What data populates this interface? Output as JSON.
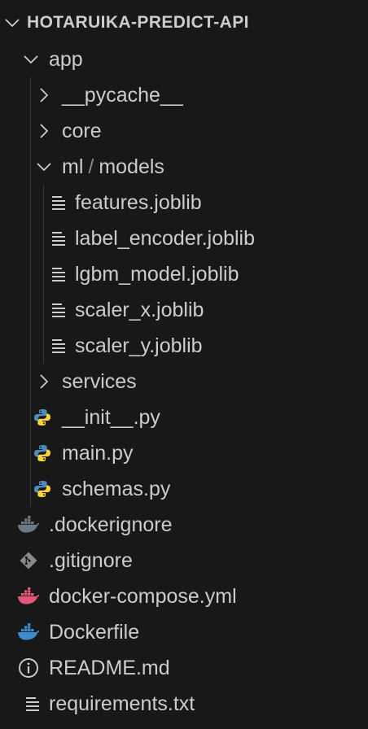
{
  "project": {
    "name": "HOTARUIKA-PREDICT-API"
  },
  "tree": {
    "app": "app",
    "pycache": "__pycache__",
    "core": "core",
    "ml": "ml",
    "ml_sep": "/",
    "models": "models",
    "features": "features.joblib",
    "label_encoder": "label_encoder.joblib",
    "lgbm_model": "lgbm_model.joblib",
    "scaler_x": "scaler_x.joblib",
    "scaler_y": "scaler_y.joblib",
    "services": "services",
    "init_py": "__init__.py",
    "main_py": "main.py",
    "schemas_py": "schemas.py",
    "dockerignore": ".dockerignore",
    "gitignore": ".gitignore",
    "docker_compose": "docker-compose.yml",
    "dockerfile": "Dockerfile",
    "readme": "README.md",
    "requirements": "requirements.txt"
  },
  "colors": {
    "background": "#181818",
    "text": "#cccccc",
    "python_blue": "#4b8bbe",
    "python_yellow": "#ffd43b",
    "docker_blue": "#3d8ccf",
    "docker_pink": "#e5567a",
    "docker_gray": "#6b7a85",
    "git_gray": "#8a8a8a"
  },
  "icons": {
    "expanded": "chevron-down-icon",
    "collapsed": "chevron-right-icon",
    "generic_file": "lines-file-icon",
    "python": "python-icon",
    "docker": "docker-whale-icon",
    "git": "git-icon",
    "info": "info-icon"
  }
}
